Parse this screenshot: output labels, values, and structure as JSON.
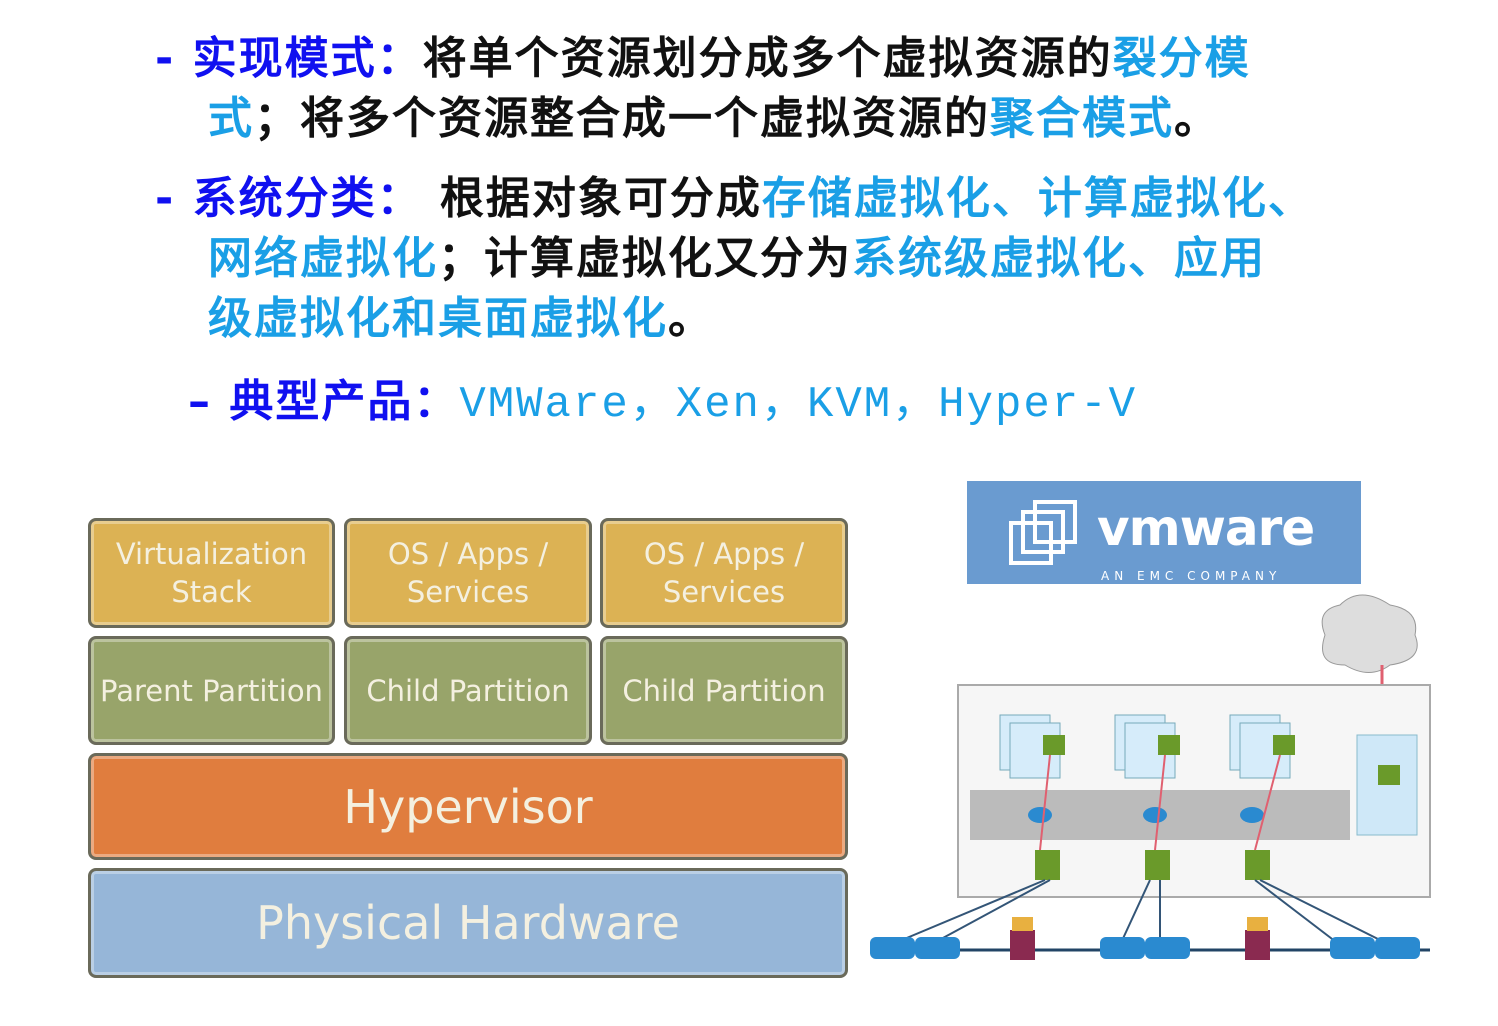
{
  "bullets": [
    {
      "dash": "-",
      "label": "实现模式：",
      "t1": "将单个资源划分成多个虚拟资源的",
      "h1": "裂分模",
      "h1b": "式",
      "t2": "；将多个资源整合成一个虚拟资源的",
      "h2": "聚合模式",
      "t3": "。"
    },
    {
      "dash": "-",
      "label": "系统分类：",
      "t1": " 根据对象可分成",
      "h1": "存储虚拟化、计算虚拟化、",
      "h1b": "网络虚拟化",
      "t2": "；计算虚拟化又分为",
      "h2": "系统级虚拟化、应用",
      "h2b": "级虚拟化和桌面虚拟化",
      "t3": "。"
    },
    {
      "dash": "–",
      "label": "典型产品：",
      "products": "VMWare，Xen，KVM，Hyper-V"
    }
  ],
  "stack": {
    "row1": [
      "Virtualization Stack",
      "OS / Apps / Services",
      "OS / Apps / Services"
    ],
    "row2": [
      "Parent Partition",
      "Child Partition",
      "Child Partition"
    ],
    "hypervisor": "Hypervisor",
    "hardware": "Physical Hardware"
  },
  "vmware": {
    "logo": "vmware",
    "tagline": "AN EMC COMPANY"
  }
}
